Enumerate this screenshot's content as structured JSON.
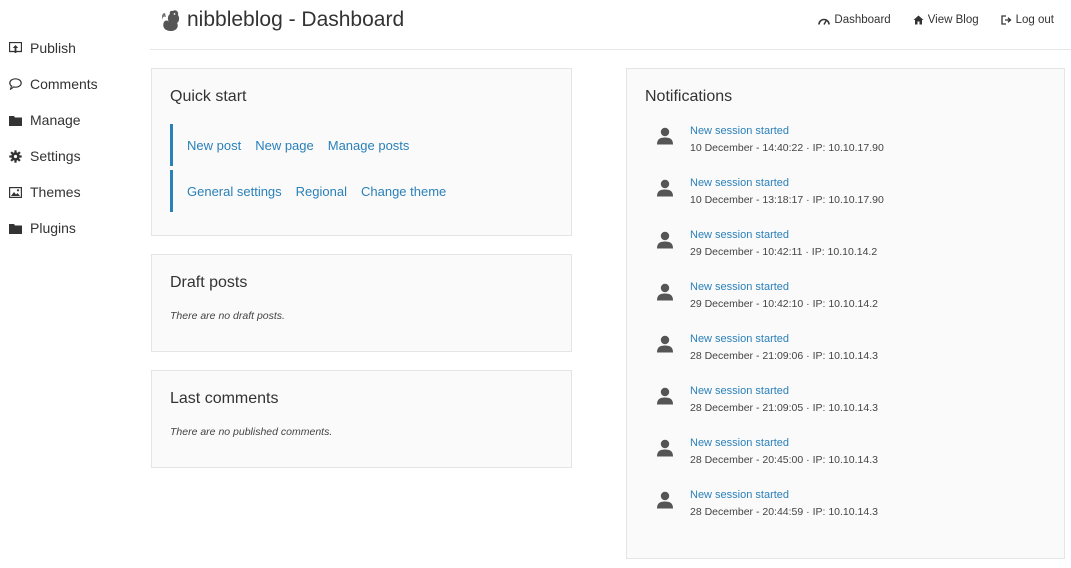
{
  "sidebar": {
    "items": [
      {
        "label": "Publish"
      },
      {
        "label": "Comments"
      },
      {
        "label": "Manage"
      },
      {
        "label": "Settings"
      },
      {
        "label": "Themes"
      },
      {
        "label": "Plugins"
      }
    ]
  },
  "header": {
    "title": "nibbleblog - Dashboard",
    "nav": {
      "dashboard": "Dashboard",
      "view_blog": "View Blog",
      "log_out": "Log out"
    }
  },
  "quick_start": {
    "title": "Quick start",
    "row1": [
      "New post",
      "New page",
      "Manage posts"
    ],
    "row2": [
      "General settings",
      "Regional",
      "Change theme"
    ]
  },
  "draft_posts": {
    "title": "Draft posts",
    "empty": "There are no draft posts."
  },
  "last_comments": {
    "title": "Last comments",
    "empty": "There are no published comments."
  },
  "notifications": {
    "title": "Notifications",
    "items": [
      {
        "title": "New session started",
        "desc": "10 December - 14:40:22 · IP: 10.10.17.90"
      },
      {
        "title": "New session started",
        "desc": "10 December - 13:18:17 · IP: 10.10.17.90"
      },
      {
        "title": "New session started",
        "desc": "29 December - 10:42:11 · IP: 10.10.14.2"
      },
      {
        "title": "New session started",
        "desc": "29 December - 10:42:10 · IP: 10.10.14.2"
      },
      {
        "title": "New session started",
        "desc": "28 December - 21:09:06 · IP: 10.10.14.3"
      },
      {
        "title": "New session started",
        "desc": "28 December - 21:09:05 · IP: 10.10.14.3"
      },
      {
        "title": "New session started",
        "desc": "28 December - 20:45:00 · IP: 10.10.14.3"
      },
      {
        "title": "New session started",
        "desc": "28 December - 20:44:59 · IP: 10.10.14.3"
      }
    ]
  },
  "colors": {
    "link": "#2a80b9",
    "panel_bg": "#fafafa",
    "text": "#333333"
  }
}
